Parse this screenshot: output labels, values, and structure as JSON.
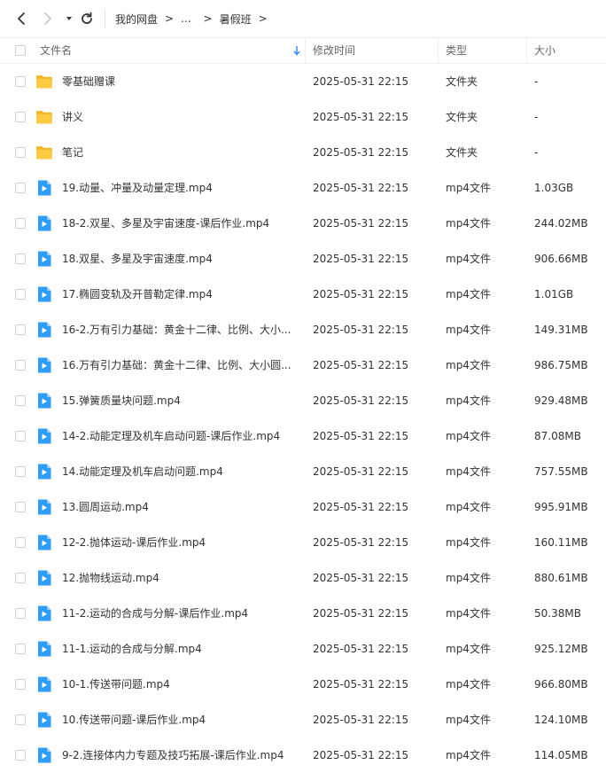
{
  "toolbar": {
    "breadcrumb": [
      "我的网盘",
      "...",
      "暑假班"
    ],
    "separator": ">"
  },
  "header": {
    "name": "文件名",
    "modified": "修改时间",
    "type": "类型",
    "size": "大小"
  },
  "colors": {
    "folder": "#f9c33b",
    "video": "#2f9df5",
    "sort_arrow": "#2b87f0"
  },
  "files": [
    {
      "kind": "folder",
      "name": "零基础赠课",
      "time": "2025-05-31 22:15",
      "type": "文件夹",
      "size": "-"
    },
    {
      "kind": "folder",
      "name": "讲义",
      "time": "2025-05-31 22:15",
      "type": "文件夹",
      "size": "-"
    },
    {
      "kind": "folder",
      "name": "笔记",
      "time": "2025-05-31 22:15",
      "type": "文件夹",
      "size": "-"
    },
    {
      "kind": "video",
      "name": "19.动量、冲量及动量定理.mp4",
      "time": "2025-05-31 22:15",
      "type": "mp4文件",
      "size": "1.03GB"
    },
    {
      "kind": "video",
      "name": "18-2.双星、多星及宇宙速度-课后作业.mp4",
      "time": "2025-05-31 22:15",
      "type": "mp4文件",
      "size": "244.02MB"
    },
    {
      "kind": "video",
      "name": "18.双星、多星及宇宙速度.mp4",
      "time": "2025-05-31 22:15",
      "type": "mp4文件",
      "size": "906.66MB"
    },
    {
      "kind": "video",
      "name": "17.椭圆变轨及开普勒定律.mp4",
      "time": "2025-05-31 22:15",
      "type": "mp4文件",
      "size": "1.01GB"
    },
    {
      "kind": "video",
      "name": "16-2.万有引力基础：黄金十二律、比例、大小...",
      "time": "2025-05-31 22:15",
      "type": "mp4文件",
      "size": "149.31MB"
    },
    {
      "kind": "video",
      "name": "16.万有引力基础：黄金十二律、比例、大小圆...",
      "time": "2025-05-31 22:15",
      "type": "mp4文件",
      "size": "986.75MB"
    },
    {
      "kind": "video",
      "name": "15.弹簧质量块问题.mp4",
      "time": "2025-05-31 22:15",
      "type": "mp4文件",
      "size": "929.48MB"
    },
    {
      "kind": "video",
      "name": "14-2.动能定理及机车启动问题-课后作业.mp4",
      "time": "2025-05-31 22:15",
      "type": "mp4文件",
      "size": "87.08MB"
    },
    {
      "kind": "video",
      "name": "14.动能定理及机车启动问题.mp4",
      "time": "2025-05-31 22:15",
      "type": "mp4文件",
      "size": "757.55MB"
    },
    {
      "kind": "video",
      "name": "13.圆周运动.mp4",
      "time": "2025-05-31 22:15",
      "type": "mp4文件",
      "size": "995.91MB"
    },
    {
      "kind": "video",
      "name": "12-2.抛体运动-课后作业.mp4",
      "time": "2025-05-31 22:15",
      "type": "mp4文件",
      "size": "160.11MB"
    },
    {
      "kind": "video",
      "name": "12.抛物线运动.mp4",
      "time": "2025-05-31 22:15",
      "type": "mp4文件",
      "size": "880.61MB"
    },
    {
      "kind": "video",
      "name": "11-2.运动的合成与分解-课后作业.mp4",
      "time": "2025-05-31 22:15",
      "type": "mp4文件",
      "size": "50.38MB"
    },
    {
      "kind": "video",
      "name": "11-1.运动的合成与分解.mp4",
      "time": "2025-05-31 22:15",
      "type": "mp4文件",
      "size": "925.12MB"
    },
    {
      "kind": "video",
      "name": "10-1.传送带问题.mp4",
      "time": "2025-05-31 22:15",
      "type": "mp4文件",
      "size": "966.80MB"
    },
    {
      "kind": "video",
      "name": "10.传送带问题-课后作业.mp4",
      "time": "2025-05-31 22:15",
      "type": "mp4文件",
      "size": "124.10MB"
    },
    {
      "kind": "video",
      "name": "9-2.连接体内力专题及技巧拓展-课后作业.mp4",
      "time": "2025-05-31 22:15",
      "type": "mp4文件",
      "size": "114.05MB"
    }
  ]
}
